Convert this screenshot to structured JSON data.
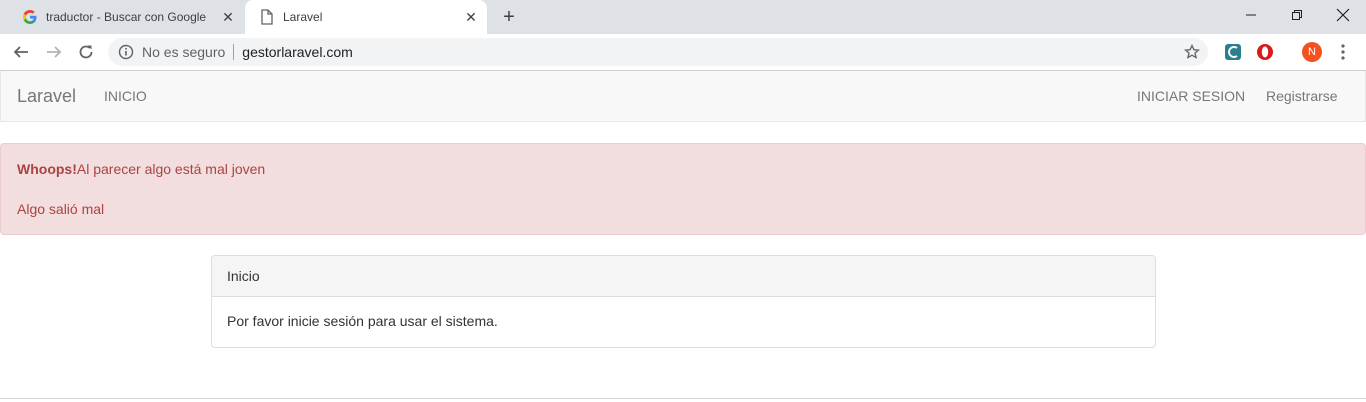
{
  "browser": {
    "tabs": [
      {
        "title": "traductor - Buscar con Google",
        "active": false
      },
      {
        "title": "Laravel",
        "active": true
      }
    ],
    "security_label": "No es seguro",
    "url": "gestorlaravel.com",
    "avatar_initial": "N",
    "accent": "#f4511e"
  },
  "navbar": {
    "brand": "Laravel",
    "home": "INICIO",
    "login": "INICIAR SESION",
    "register": "Registrarse"
  },
  "alert": {
    "strong": "Whoops!",
    "message": "Al parecer algo está mal joven",
    "detail": "Algo salió mal",
    "color": "#a94442",
    "background": "#f2dede"
  },
  "panel": {
    "heading": "Inicio",
    "body": "Por favor inicie sesión para usar el sistema."
  }
}
